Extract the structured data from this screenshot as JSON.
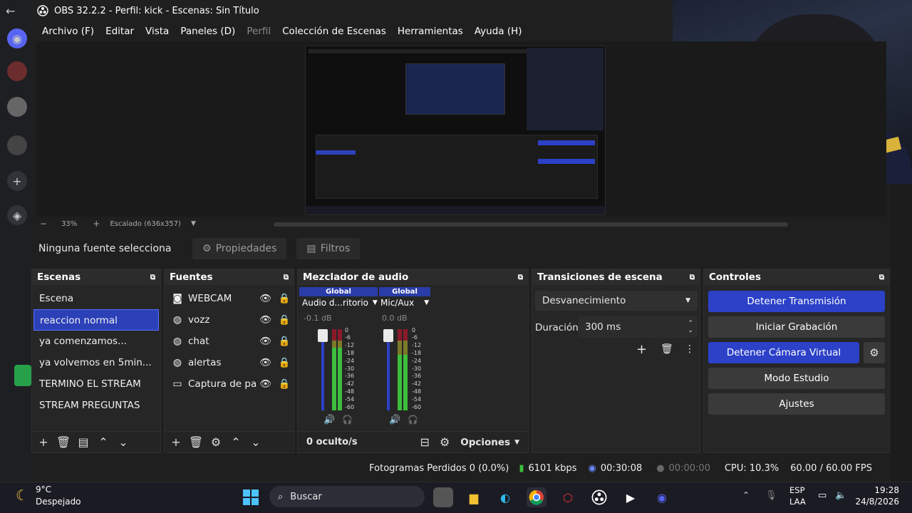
{
  "window": {
    "title": "OBS 32.2.2 - Perfil: kick - Escenas: Sin Título"
  },
  "menu": [
    {
      "label": "Archivo (F)",
      "disabled": false
    },
    {
      "label": "Editar",
      "disabled": false
    },
    {
      "label": "Vista",
      "disabled": false
    },
    {
      "label": "Paneles (D)",
      "disabled": false
    },
    {
      "label": "Perfil",
      "disabled": true
    },
    {
      "label": "Colección de Escenas",
      "disabled": false
    },
    {
      "label": "Herramientas",
      "disabled": false
    },
    {
      "label": "Ayuda (H)",
      "disabled": false
    }
  ],
  "preview": {
    "zoom": "33%",
    "scale_label": "Escalado (636x357)"
  },
  "source_toolbar": {
    "no_source": "Ninguna fuente selecciona",
    "properties": "Propiedades",
    "filters": "Filtros"
  },
  "scenes": {
    "title": "Escenas",
    "items": [
      "Escena",
      "reaccion normal",
      "ya comenzamos...",
      "ya volvemos en 5min...",
      "TERMINO EL STREAM",
      "STREAM PREGUNTAS"
    ],
    "selected_index": 1
  },
  "sources": {
    "title": "Fuentes",
    "items": [
      {
        "name": "WEBCAM",
        "icon": "camera-icon"
      },
      {
        "name": "vozz",
        "icon": "globe-icon"
      },
      {
        "name": "chat",
        "icon": "globe-icon"
      },
      {
        "name": "alertas",
        "icon": "globe-icon"
      },
      {
        "name": "Captura de par",
        "icon": "monitor-icon"
      }
    ]
  },
  "mixer": {
    "title": "Mezclador de audio",
    "channels": [
      {
        "badge": "Global",
        "name": "Audio d...ritorio",
        "db": "-0.1 dB"
      },
      {
        "badge": "Global",
        "name": "Mic/Aux",
        "db": "0.0 dB"
      }
    ],
    "ticks": [
      "0",
      "-6",
      "-12",
      "-18",
      "-24",
      "-30",
      "-36",
      "-42",
      "-48",
      "-54",
      "-60"
    ],
    "hidden": "0 oculto/s",
    "options": "Opciones"
  },
  "transitions": {
    "title": "Transiciones de escena",
    "selected": "Desvanecimiento",
    "duration_label": "Duración",
    "duration_value": "300 ms"
  },
  "controls": {
    "title": "Controles",
    "buttons": [
      "Detener Transmisión",
      "Iniciar Grabación",
      "Detener Cámara Virtual",
      "Modo Estudio",
      "Ajustes"
    ]
  },
  "status": {
    "dropped": "Fotogramas Perdidos 0 (0.0%)",
    "bitrate": "6101 kbps",
    "stream_time": "00:30:08",
    "rec_time": "00:00:00",
    "cpu": "CPU: 10.3%",
    "fps": "60.00 / 60.00 FPS"
  },
  "taskbar": {
    "weather_temp": "9°C",
    "weather_desc": "Despejado",
    "search": "Buscar",
    "lang_1": "ESP",
    "lang_2": "LAA",
    "time": "19:28",
    "date": "24/8/2026"
  },
  "colors": {
    "accent": "#2c41c8",
    "selected_scene": "#2c41b8",
    "meter_green": "#3cbf3c",
    "meter_red": "#8a1a2a"
  }
}
